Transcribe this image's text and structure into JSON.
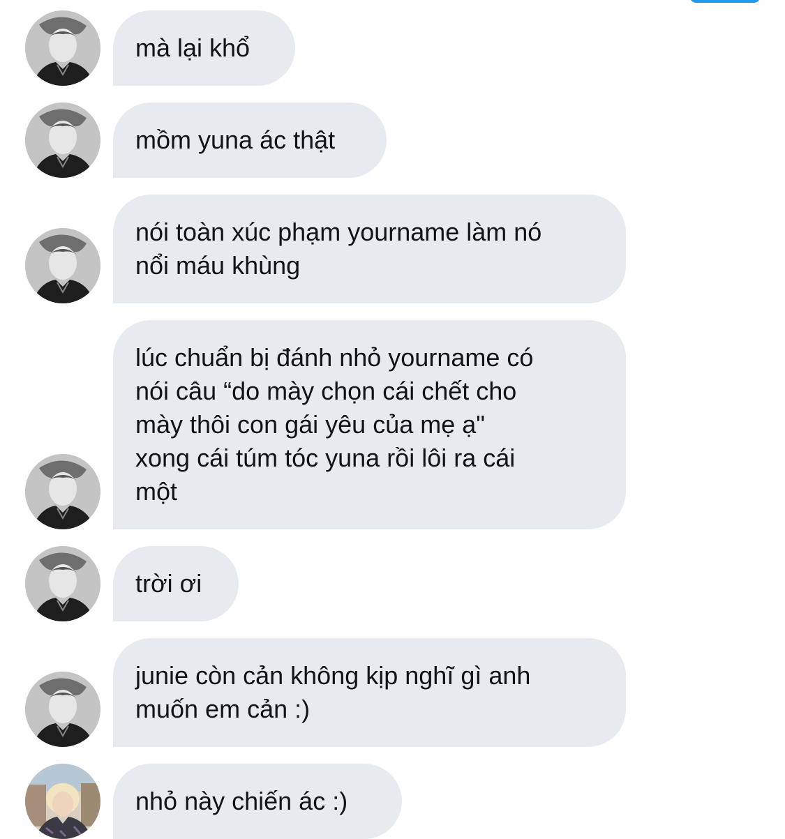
{
  "conversation": {
    "messages": [
      {
        "text": "mà lại khổ",
        "avatar": "contact-avatar-grayscale"
      },
      {
        "text": "mồm yuna ác thật",
        "avatar": "contact-avatar-grayscale"
      },
      {
        "text": "nói toàn xúc phạm yourname làm nó\nnổi máu khùng",
        "avatar": "contact-avatar-grayscale"
      },
      {
        "text": "lúc chuẩn bị đánh nhỏ yourname có\nnói câu “do mày chọn cái chết cho\nmày thôi con gái yêu của mẹ ạ\"\nxong cái túm tóc yuna rồi lôi ra cái\nmột",
        "avatar": "contact-avatar-grayscale"
      },
      {
        "text": "trời ơi",
        "avatar": "contact-avatar-grayscale"
      },
      {
        "text": "junie còn cản không kịp nghĩ gì anh\nmuốn em cản :)",
        "avatar": "contact-avatar-grayscale"
      },
      {
        "text": "nhỏ này chiến ác :)",
        "avatar": "contact-avatar-blonde"
      }
    ]
  },
  "colors": {
    "bubble_background": "#e7ebef",
    "text": "#0f1419",
    "accent": "#1d9bf0"
  }
}
